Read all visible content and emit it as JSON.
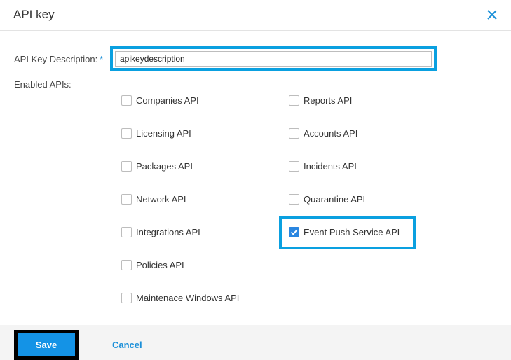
{
  "dialog": {
    "title": "API key",
    "close_icon": "close-x-icon"
  },
  "form": {
    "description_label": "API Key Description:",
    "required_marker": "*",
    "description_value": "apikeydescription",
    "enabled_apis_label": "Enabled APIs:"
  },
  "apis": {
    "left": [
      {
        "label": "Companies API",
        "checked": false
      },
      {
        "label": "Licensing API",
        "checked": false
      },
      {
        "label": "Packages API",
        "checked": false
      },
      {
        "label": "Network API",
        "checked": false
      },
      {
        "label": "Integrations API",
        "checked": false
      },
      {
        "label": "Policies API",
        "checked": false
      },
      {
        "label": "Maintenace Windows API",
        "checked": false
      }
    ],
    "right": [
      {
        "label": "Reports API",
        "checked": false
      },
      {
        "label": "Accounts API",
        "checked": false
      },
      {
        "label": "Incidents API",
        "checked": false
      },
      {
        "label": "Quarantine API",
        "checked": false
      },
      {
        "label": "Event Push Service API",
        "checked": true
      }
    ]
  },
  "footer": {
    "save_label": "Save",
    "cancel_label": "Cancel"
  },
  "colors": {
    "accent": "#1493e6",
    "highlight": "#0aa0e0",
    "checkbox_checked": "#2a86e0"
  }
}
